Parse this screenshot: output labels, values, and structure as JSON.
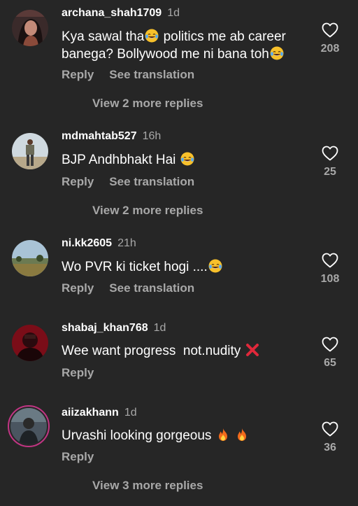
{
  "comments": [
    {
      "username": "archana_shah1709",
      "time": "1d",
      "text_parts": [
        "Kya sawal tha",
        " politics me ab career banega? Bollywood me ni bana toh"
      ],
      "reply_label": "Reply",
      "translate_label": "See translation",
      "view_more": "View 2 more replies",
      "likes": "208"
    },
    {
      "username": "mdmahtab527",
      "time": "16h",
      "text": "BJP Andhbhakt Hai",
      "reply_label": "Reply",
      "translate_label": "See translation",
      "view_more": "View 2 more replies",
      "likes": "25"
    },
    {
      "username": "ni.kk2605",
      "time": "21h",
      "text": "Wo PVR ki ticket hogi ....",
      "reply_label": "Reply",
      "translate_label": "See translation",
      "likes": "108"
    },
    {
      "username": "shabaj_khan768",
      "time": "1d",
      "text": "Wee want progress  not.nudity",
      "reply_label": "Reply",
      "likes": "65"
    },
    {
      "username": "aiizakhann",
      "time": "1d",
      "text": "Urvashi looking gorgeous",
      "reply_label": "Reply",
      "view_more": "View 3 more replies",
      "likes": "36"
    }
  ],
  "icons": {
    "like": "heart-outline-icon",
    "laugh": "face-with-tears-of-joy-emoji",
    "fire": "fire-emoji",
    "cross": "cross-mark-emoji"
  },
  "colors": {
    "background": "#262626",
    "primary_text": "#ffffff",
    "secondary_text": "#a8a8a8",
    "story_ring": "#c13584"
  }
}
